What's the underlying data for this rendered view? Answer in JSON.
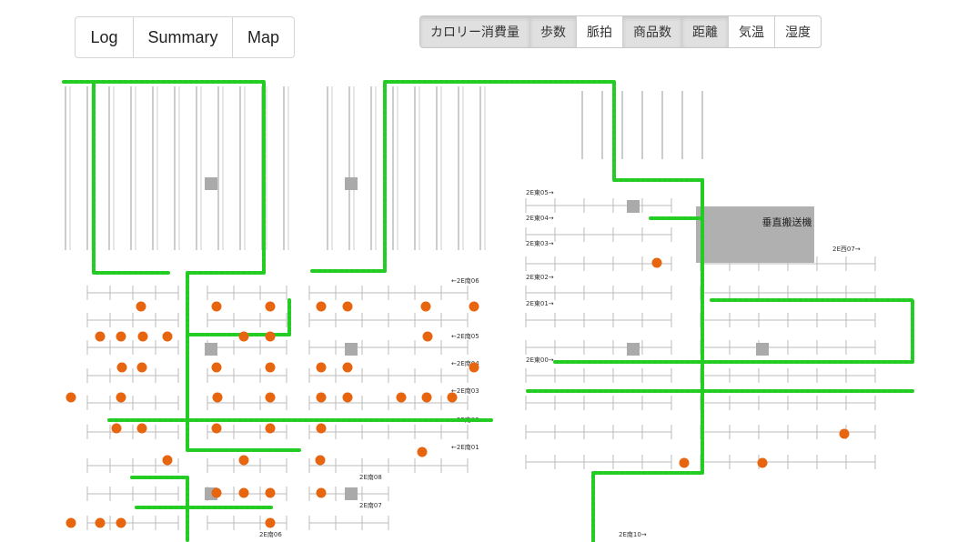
{
  "nav": {
    "tabs": [
      {
        "label": "Log"
      },
      {
        "label": "Summary"
      },
      {
        "label": "Map"
      }
    ]
  },
  "metrics": {
    "buttons": [
      {
        "label": "カロリー消費量",
        "active": true
      },
      {
        "label": "歩数",
        "active": true
      },
      {
        "label": "脈拍",
        "active": false
      },
      {
        "label": "商品数",
        "active": true
      },
      {
        "label": "距離",
        "active": true
      },
      {
        "label": "気温",
        "active": false
      },
      {
        "label": "湿度",
        "active": false
      }
    ]
  },
  "map": {
    "elevator_label": "垂直搬送機",
    "aisle_labels": [
      "←2E南06",
      "←2E南05",
      "←2E南04",
      "←2E南03",
      "←2E南02",
      "←2E南01",
      "2E南08",
      "2E南07",
      "2E南06",
      "2E東05→",
      "2E東04→",
      "2E東03→",
      "2E東02→",
      "2E東01→",
      "2E南10→",
      "2E東00→",
      "2E西07→"
    ],
    "colors": {
      "route": "#22cc22",
      "order_point": "#e8650f",
      "shelf": "#bbbbbb",
      "pillar": "#aaaaaa",
      "elevator": "#b0b0b0"
    }
  }
}
